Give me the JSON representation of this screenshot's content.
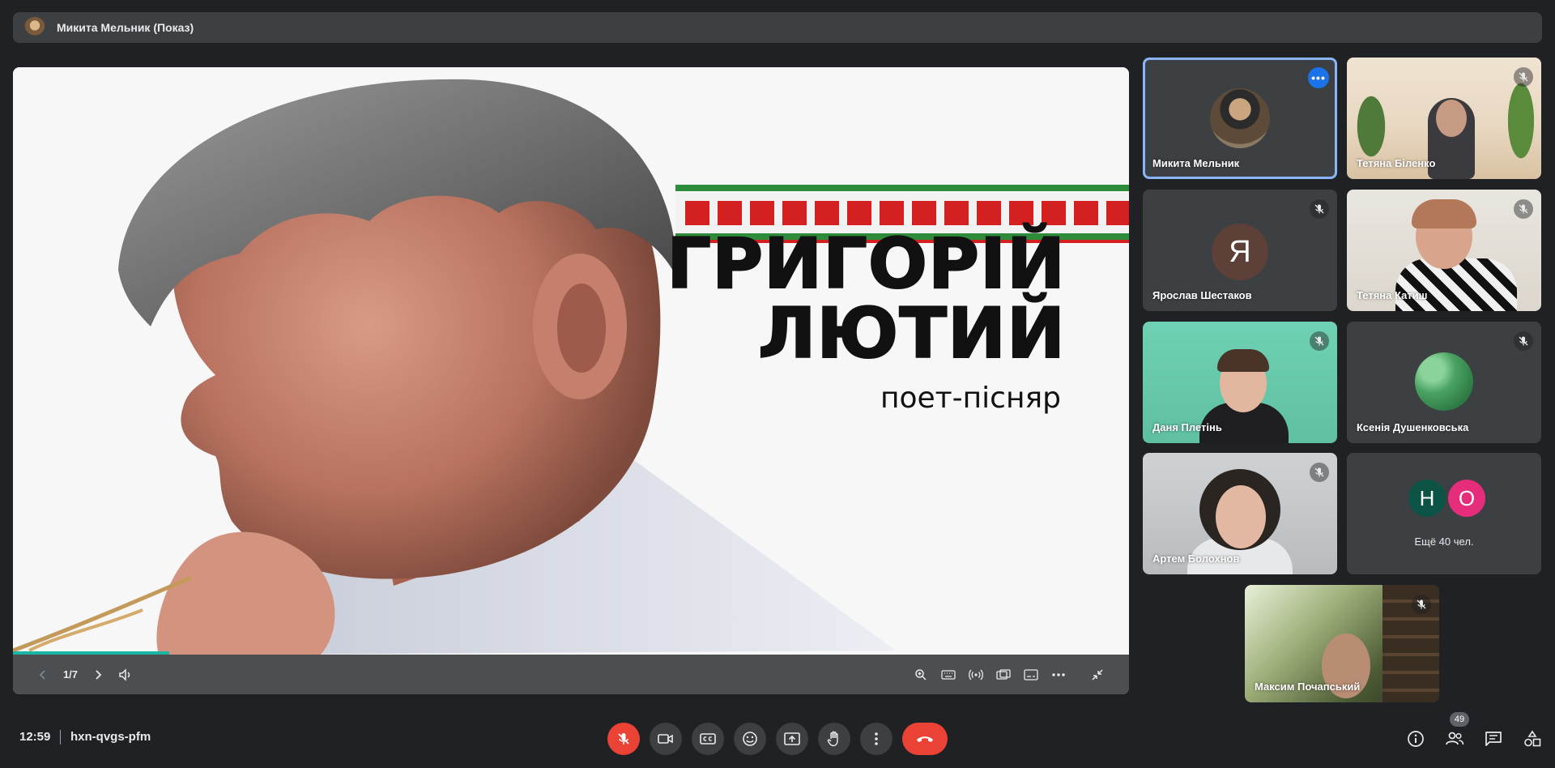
{
  "presenter_bar": {
    "title": "Микита Мельник (Показ)"
  },
  "slide": {
    "title_line1": "ГРИГОРІЙ",
    "title_line2": "ЛЮТИЙ",
    "subtitle": "поет-пісняр",
    "counter": "1/7",
    "progress_fraction": 0.14
  },
  "participants": [
    {
      "name": "Микита Мельник",
      "active": true
    },
    {
      "name": "Тетяна Біленко"
    },
    {
      "name": "Ярослав Шестаков",
      "avatar_letter": "Я",
      "avatar_color": "#5d4037"
    },
    {
      "name": "Тетяна Катиш"
    },
    {
      "name": "Даня Плетінь"
    },
    {
      "name": "Ксенія Душенковська"
    },
    {
      "name": "Артем Болохнов"
    },
    {
      "name": "Максим Почапський"
    }
  ],
  "more_tile": {
    "avatars": [
      {
        "letter": "Н",
        "color": "#0b5345"
      },
      {
        "letter": "О",
        "color": "#e52d7b"
      }
    ],
    "text": "Ещё 40 чел."
  },
  "bottom": {
    "time": "12:59",
    "meeting_code": "hxn-qvgs-pfm",
    "participants_count": "49"
  },
  "colors": {
    "accent": "#1a73e8",
    "danger": "#ea4335",
    "active_outline": "#8ab4f8",
    "progress": "#1bb5a3"
  }
}
